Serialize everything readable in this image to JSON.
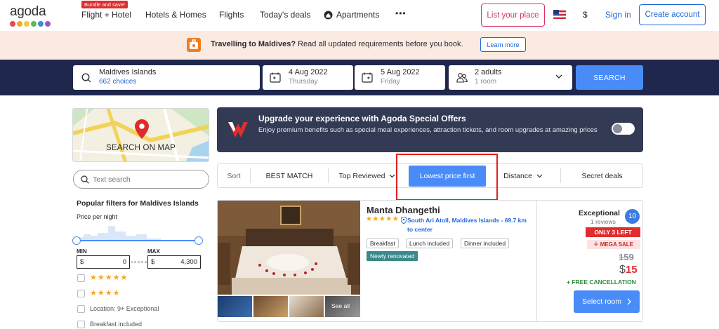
{
  "header": {
    "logo": "agoda",
    "logo_dot_colors": [
      "#e5484d",
      "#f5a623",
      "#f0c93e",
      "#5cb85c",
      "#3d8bd9",
      "#9b59b6"
    ],
    "bundle_badge": "Bundle and save!",
    "nav": [
      "Flight + Hotel",
      "Hotels & Homes",
      "Flights",
      "Today's deals",
      "Apartments"
    ],
    "more_label": "•••",
    "list_your_place": "List your place",
    "currency": "$",
    "sign_in": "Sign in",
    "create_account": "Create account"
  },
  "banner": {
    "bold": "Travelling to Maldives?",
    "text": " Read all updated requirements before you book.",
    "learn_more": "Learn more"
  },
  "search": {
    "destination": "Maldives Islands",
    "choices": "662 choices",
    "checkin_date": "4 Aug 2022",
    "checkin_day": "Thursday",
    "checkout_date": "5 Aug 2022",
    "checkout_day": "Friday",
    "guests": "2 adults",
    "rooms": "1 room",
    "button": "SEARCH"
  },
  "sidebar": {
    "map_label": "SEARCH ON MAP",
    "text_search_placeholder": "Text search",
    "filters_title": "Popular filters for Maldives Islands",
    "price_per_night": "Price per night",
    "min_label": "MIN",
    "max_label": "MAX",
    "min_currency": "$",
    "min_value": "0",
    "max_currency": "$",
    "max_value": "4,300",
    "filters": [
      {
        "label": "★★★★★",
        "type": "stars"
      },
      {
        "label": "★★★★",
        "type": "stars"
      },
      {
        "label": "Location: 9+ Exceptional",
        "type": "text"
      },
      {
        "label": "Breakfast included",
        "type": "text"
      }
    ]
  },
  "promo": {
    "title": "Upgrade your experience with Agoda Special Offers",
    "subtitle": "Enjoy premium benefits such as special meal experiences, attraction tickets, and room upgrades at amazing prices",
    "toggle_on": false
  },
  "sort": {
    "label": "Sort",
    "options": [
      "BEST MATCH",
      "Top Reviewed",
      "Lowest price first",
      "Distance",
      "Secret deals"
    ],
    "active": "Lowest price first"
  },
  "hotel": {
    "name": "Manta Dhangethi",
    "stars": "★★★★★",
    "location": "South Ari Atoll, Maldives Islands - 69.7 km to center",
    "amenities": [
      "Breakfast",
      "Lunch included",
      "Dinner included"
    ],
    "badge": "Newly renovated",
    "see_all": "See all",
    "rating_word": "Exceptional",
    "rating_count": "1 reviews",
    "rating_score": "10",
    "only_left": "ONLY 3 LEFT",
    "mega_sale": "MEGA SALE",
    "old_price": "159",
    "currency": "$",
    "price": "15",
    "free_cancellation": "+ FREE CANCELLATION",
    "select_room": "Select room"
  }
}
